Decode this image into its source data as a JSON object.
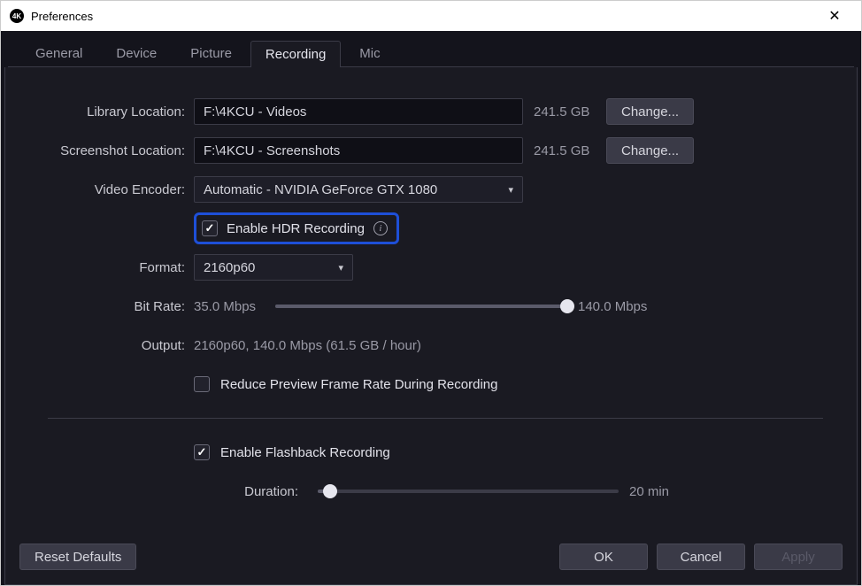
{
  "window": {
    "title": "Preferences"
  },
  "tabs": [
    "General",
    "Device",
    "Picture",
    "Recording",
    "Mic"
  ],
  "active_tab": "Recording",
  "labels": {
    "library_location": "Library Location:",
    "screenshot_location": "Screenshot Location:",
    "video_encoder": "Video Encoder:",
    "format": "Format:",
    "bit_rate": "Bit Rate:",
    "output": "Output:",
    "duration": "Duration:"
  },
  "library": {
    "path": "F:\\4KCU - Videos",
    "free": "241.5 GB",
    "change": "Change..."
  },
  "screenshot": {
    "path": "F:\\4KCU - Screenshots",
    "free": "241.5 GB",
    "change": "Change..."
  },
  "encoder": {
    "value": "Automatic - NVIDIA GeForce GTX 1080"
  },
  "hdr": {
    "label": "Enable HDR Recording",
    "checked": true
  },
  "format": {
    "value": "2160p60"
  },
  "bitrate": {
    "min": "35.0 Mbps",
    "max": "140.0 Mbps",
    "pos_pct": 100
  },
  "output": {
    "summary": "2160p60, 140.0 Mbps (61.5 GB / hour)"
  },
  "reduce_preview": {
    "label": "Reduce Preview Frame Rate During Recording",
    "checked": false
  },
  "flashback": {
    "label": "Enable Flashback Recording",
    "checked": true
  },
  "duration": {
    "value": "20 min",
    "pos_pct": 4
  },
  "buttons": {
    "reset": "Reset Defaults",
    "ok": "OK",
    "cancel": "Cancel",
    "apply": "Apply"
  }
}
